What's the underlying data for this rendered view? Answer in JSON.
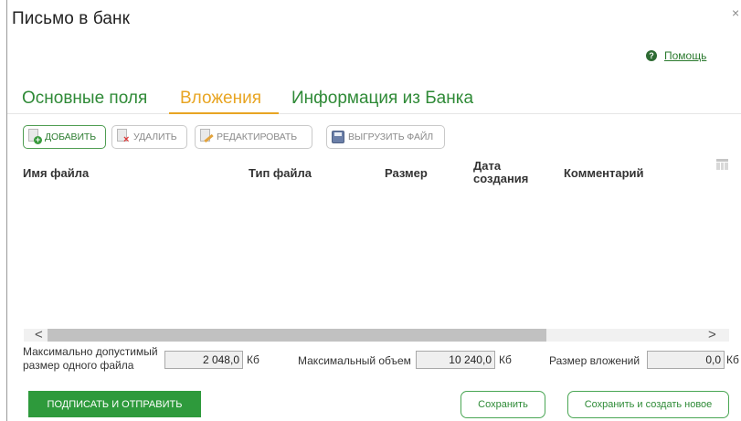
{
  "window": {
    "title": "Письмо в банк",
    "close_glyph": "×"
  },
  "help": {
    "label": "Помощь",
    "icon": "help-icon"
  },
  "tabs": [
    {
      "label": "Основные поля",
      "active": false
    },
    {
      "label": "Вложения",
      "active": true
    },
    {
      "label": "Информация из Банка",
      "active": false
    }
  ],
  "toolbar": {
    "add": "ДОБАВИТЬ",
    "delete": "УДАЛИТЬ",
    "edit": "РЕДАКТИРОВАТЬ",
    "export": "ВЫГРУЗИТЬ ФАЙЛ"
  },
  "table": {
    "columns": [
      "Имя файла",
      "Тип файла",
      "Размер",
      "Дата создания",
      "Комментарий"
    ],
    "rows": []
  },
  "limits": {
    "max_file_label": "Максимально допустимый размер одного файла",
    "max_file_value": "2 048,0",
    "max_total_label": "Максимальный объем",
    "max_total_value": "10 240,0",
    "attachments_size_label": "Размер вложений",
    "attachments_size_value": "0,0",
    "unit": "Кб"
  },
  "actions": {
    "sign_send": "ПОДПИСАТЬ И ОТПРАВИТЬ",
    "save": "Сохранить",
    "save_new": "Сохранить и создать новое"
  },
  "colors": {
    "accent_green": "#2e9a3c",
    "active_tab": "#e8a523",
    "tab_green": "#2f8a37"
  }
}
